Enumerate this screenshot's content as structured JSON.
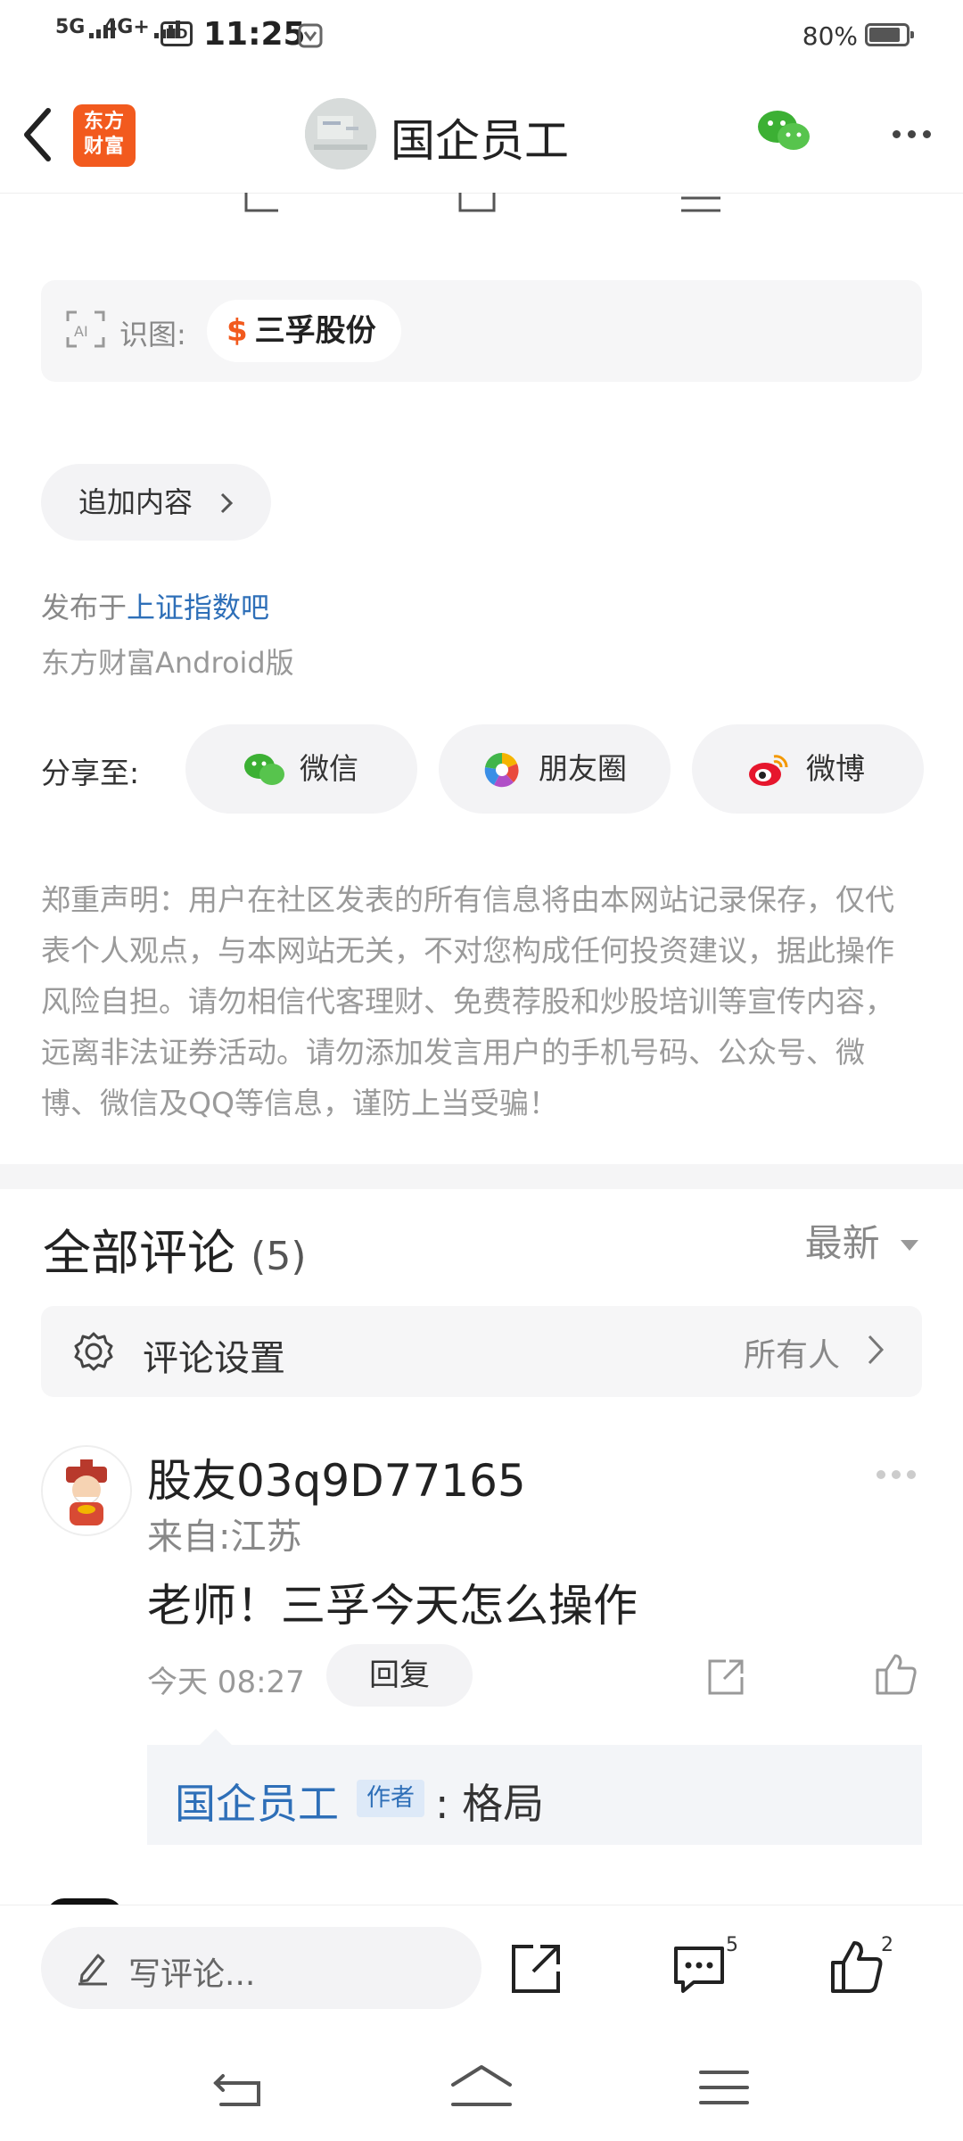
{
  "status_bar": {
    "network1": "5G",
    "network2": "4G+",
    "hd": "HD",
    "time": "11:25",
    "battery": "80%"
  },
  "header": {
    "app_logo": "东方\n财富",
    "logo_line1": "东方",
    "logo_line2": "财富",
    "author_name": "国企员工"
  },
  "post": {
    "ai_label": "识图:",
    "stock_symbol": "$",
    "stock_name": "三孚股份",
    "add_content": "追加内容",
    "publish_prefix": "发布于",
    "publish_board": "上证指数吧",
    "client": "东方财富Android版",
    "share_label": "分享至:",
    "share_wechat": "微信",
    "share_moments": "朋友圈",
    "share_weibo": "微博",
    "disclaimer": "郑重声明：用户在社区发表的所有信息将由本网站记录保存，仅代表个人观点，与本网站无关，不对您构成任何投资建议，据此操作风险自担。请勿相信代客理财、免费荐股和炒股培训等宣传内容，远离非法证券活动。请勿添加发言用户的手机号码、公众号、微博、微信及QQ等信息，谨防上当受骗！"
  },
  "comments": {
    "title": "全部评论",
    "count": "(5)",
    "sort": "最新",
    "settings_label": "评论设置",
    "settings_value": "所有人",
    "items": [
      {
        "user": "股友03q9D77165",
        "location": "来自:江苏",
        "text": "老师！三孚今天怎么操作",
        "time": "今天 08:27",
        "reply_label": "回复",
        "reply": {
          "author": "国企员工",
          "tag": "作者",
          "text": ": 格局"
        }
      }
    ]
  },
  "bottom_bar": {
    "write_placeholder": "写评论...",
    "comment_count": "5",
    "like_count": "2"
  },
  "colors": {
    "brand": "#f25a1e",
    "link": "#2e6fb8",
    "wechat_green": "#3cb034"
  }
}
